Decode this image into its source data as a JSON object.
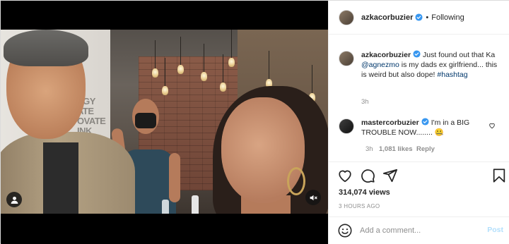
{
  "post": {
    "author": "azkacorbuzier",
    "follow_status": "Following",
    "separator": "•"
  },
  "media": {
    "wall_words": "EGY\nATE\nOVATE\nINK\nOVATE\nINK\nAN",
    "icons": {
      "user_tag": "person-icon",
      "sound": "speaker-muted-icon"
    }
  },
  "caption": {
    "username": "azkacorbuzier",
    "text_before": "Just found out that Ka ",
    "mention": "@agnezmo",
    "text_after": " is my dads ex girlfriend... this is weird but also dope! ",
    "hashtag": "#hashtag",
    "time": "3h"
  },
  "comment": {
    "username": "mastercorbuzier",
    "text": "I'm in a BIG TROUBLE NOW........ 🤐",
    "time": "3h",
    "likes": "1,081 likes",
    "reply_label": "Reply"
  },
  "stats": {
    "views": "314,074 views",
    "time_ago": "3 HOURS AGO"
  },
  "compose": {
    "placeholder": "Add a comment...",
    "post_label": "Post"
  },
  "colors": {
    "verified": "#3897f0",
    "link": "#00376b",
    "post_button": "#b2dffc",
    "muted_text": "#8e8e8e"
  }
}
